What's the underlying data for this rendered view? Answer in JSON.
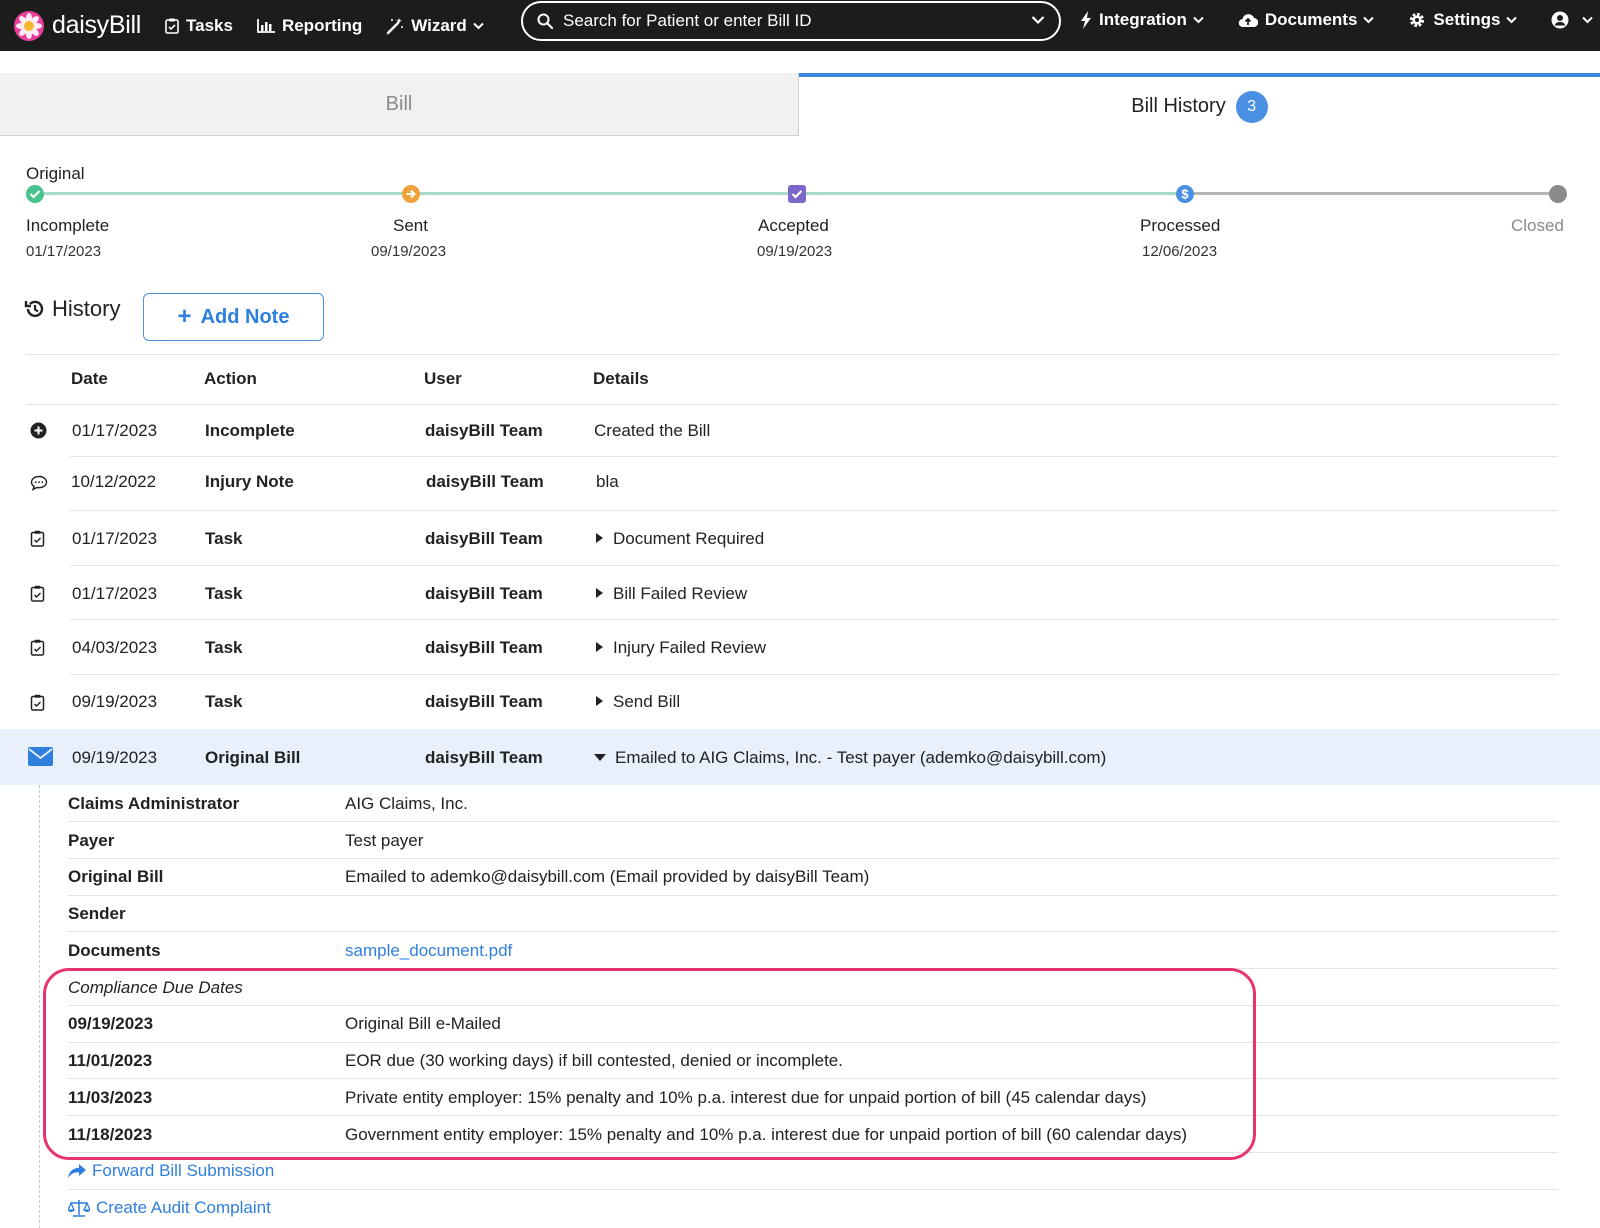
{
  "nav": {
    "brand": "daisyBill",
    "tasks": "Tasks",
    "reporting": "Reporting",
    "wizard": "Wizard",
    "search_placeholder": "Search for Patient or enter Bill ID",
    "integration": "Integration",
    "documents": "Documents",
    "settings": "Settings"
  },
  "tabs": {
    "bill": "Bill",
    "history": "Bill History",
    "history_count": "3"
  },
  "progress": {
    "label": "Original",
    "steps": [
      {
        "name": "Incomplete",
        "date": "01/17/2023"
      },
      {
        "name": "Sent",
        "date": "09/19/2023"
      },
      {
        "name": "Accepted",
        "date": "09/19/2023"
      },
      {
        "name": "Processed",
        "date": "12/06/2023"
      },
      {
        "name": "Closed",
        "date": ""
      }
    ],
    "colors": {
      "done": "#a8dcc8",
      "pending": "#b4b4b4",
      "incomplete": "#46c38e",
      "sent": "#f0a23a",
      "accepted": "#7b67c9",
      "processed": "#4a8fe2",
      "closed": "#8a8a8a"
    }
  },
  "history": {
    "title": "History",
    "add_note": "Add Note",
    "columns": {
      "date": "Date",
      "action": "Action",
      "user": "User",
      "details": "Details"
    },
    "rows": [
      {
        "icon": "plus-circle-icon",
        "date": "01/17/2023",
        "action": "Incomplete",
        "user": "daisyBill Team",
        "details": "Created the Bill"
      },
      {
        "icon": "comment-icon",
        "date": "10/12/2022",
        "action": "Injury Note",
        "user": "daisyBill Team",
        "details": "bla"
      },
      {
        "icon": "clipboard-check-icon",
        "date": "01/17/2023",
        "action": "Task",
        "user": "daisyBill Team",
        "details": "Document Required"
      },
      {
        "icon": "clipboard-check-icon",
        "date": "01/17/2023",
        "action": "Task",
        "user": "daisyBill Team",
        "details": "Bill Failed Review"
      },
      {
        "icon": "clipboard-check-icon",
        "date": "04/03/2023",
        "action": "Task",
        "user": "daisyBill Team",
        "details": "Injury Failed Review"
      },
      {
        "icon": "clipboard-check-icon",
        "date": "09/19/2023",
        "action": "Task",
        "user": "daisyBill Team",
        "details": "Send Bill"
      },
      {
        "icon": "envelope-icon",
        "date": "09/19/2023",
        "action": "Original Bill",
        "user": "daisyBill Team",
        "details": "Emailed to AIG Claims, Inc. - Test payer (ademko@daisybill.com)"
      }
    ],
    "expanded": {
      "fields": [
        {
          "label": "Claims Administrator",
          "value": "AIG Claims, Inc."
        },
        {
          "label": "Payer",
          "value": "Test payer"
        },
        {
          "label": "Original Bill",
          "value": "Emailed to ademko@daisybill.com (Email provided by daisyBill Team)"
        },
        {
          "label": "Sender",
          "value": ""
        },
        {
          "label": "Documents",
          "value": "sample_document.pdf"
        }
      ],
      "compliance_title": "Compliance Due Dates",
      "compliance": [
        {
          "date": "09/19/2023",
          "text": "Original Bill e-Mailed"
        },
        {
          "date": "11/01/2023",
          "text": "EOR due (30 working days) if bill contested, denied or incomplete."
        },
        {
          "date": "11/03/2023",
          "text": "Private entity employer: 15% penalty and 10% p.a. interest due for unpaid portion of bill (45 calendar days)"
        },
        {
          "date": "11/18/2023",
          "text": "Government entity employer: 15% penalty and 10% p.a. interest due for unpaid portion of bill (60 calendar days)"
        }
      ],
      "actions": {
        "forward": "Forward Bill Submission",
        "audit": "Create Audit Complaint"
      }
    }
  },
  "colors": {
    "accent": "#2f7fde",
    "highlight_row": "#e8f0fb",
    "annotation": "#e8336d",
    "navbar": "#1c1c1c"
  }
}
